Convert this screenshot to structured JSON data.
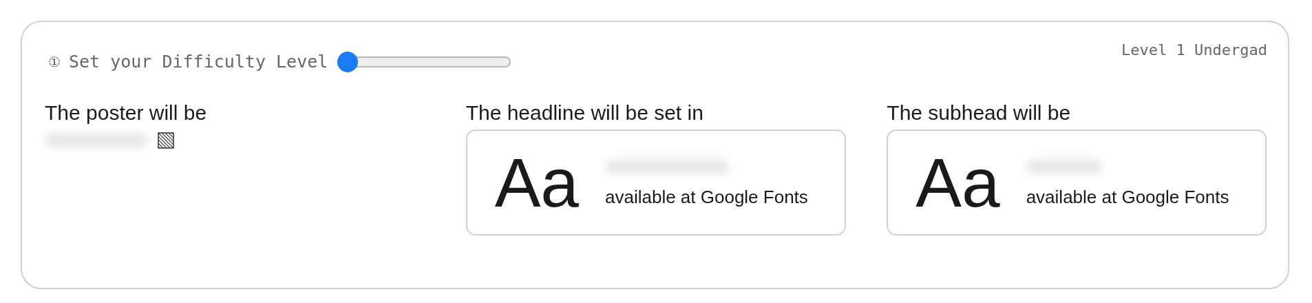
{
  "difficulty": {
    "step": "①",
    "label": "Set your Difficulty Level",
    "level": 0,
    "reading": "Level 1 Undergad"
  },
  "columns": [
    {
      "kind": "poster",
      "heading": "The poster will be"
    },
    {
      "kind": "font",
      "heading": "The headline will be set in",
      "sample": "Aa",
      "note": "available at Google Fonts"
    },
    {
      "kind": "font",
      "heading": "The subhead will be",
      "sample": "Aa",
      "note": "available at Google Fonts"
    }
  ]
}
